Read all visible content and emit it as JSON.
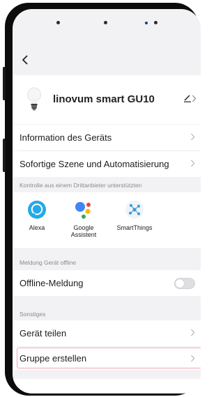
{
  "device": {
    "name": "linovum smart GU10"
  },
  "menu": {
    "info": "Information des Geräts",
    "scene": "Sofortige Szene und Automatisierung"
  },
  "third_party": {
    "section_label": "Kontrolle aus einem Drittanbieter unterstützten",
    "items": [
      {
        "label": "Alexa",
        "icon": "alexa-icon"
      },
      {
        "label": "Google\nAssistent",
        "icon": "google-assistant-icon"
      },
      {
        "label": "SmartThings",
        "icon": "smartthings-icon"
      }
    ]
  },
  "offline": {
    "section_label": "Meldung Gerät offline",
    "label": "Offline-Meldung",
    "enabled": false
  },
  "other": {
    "section_label": "Sonstiges",
    "share": "Gerät teilen",
    "group": "Gruppe erstellen"
  },
  "colors": {
    "alexa": "#25a9e8",
    "google_blue": "#4285f4",
    "google_red": "#ea4335",
    "google_yellow": "#fbbc05",
    "google_green": "#34a853",
    "smartthings": "#3f9ad6",
    "highlight": "#f4a6b2"
  }
}
